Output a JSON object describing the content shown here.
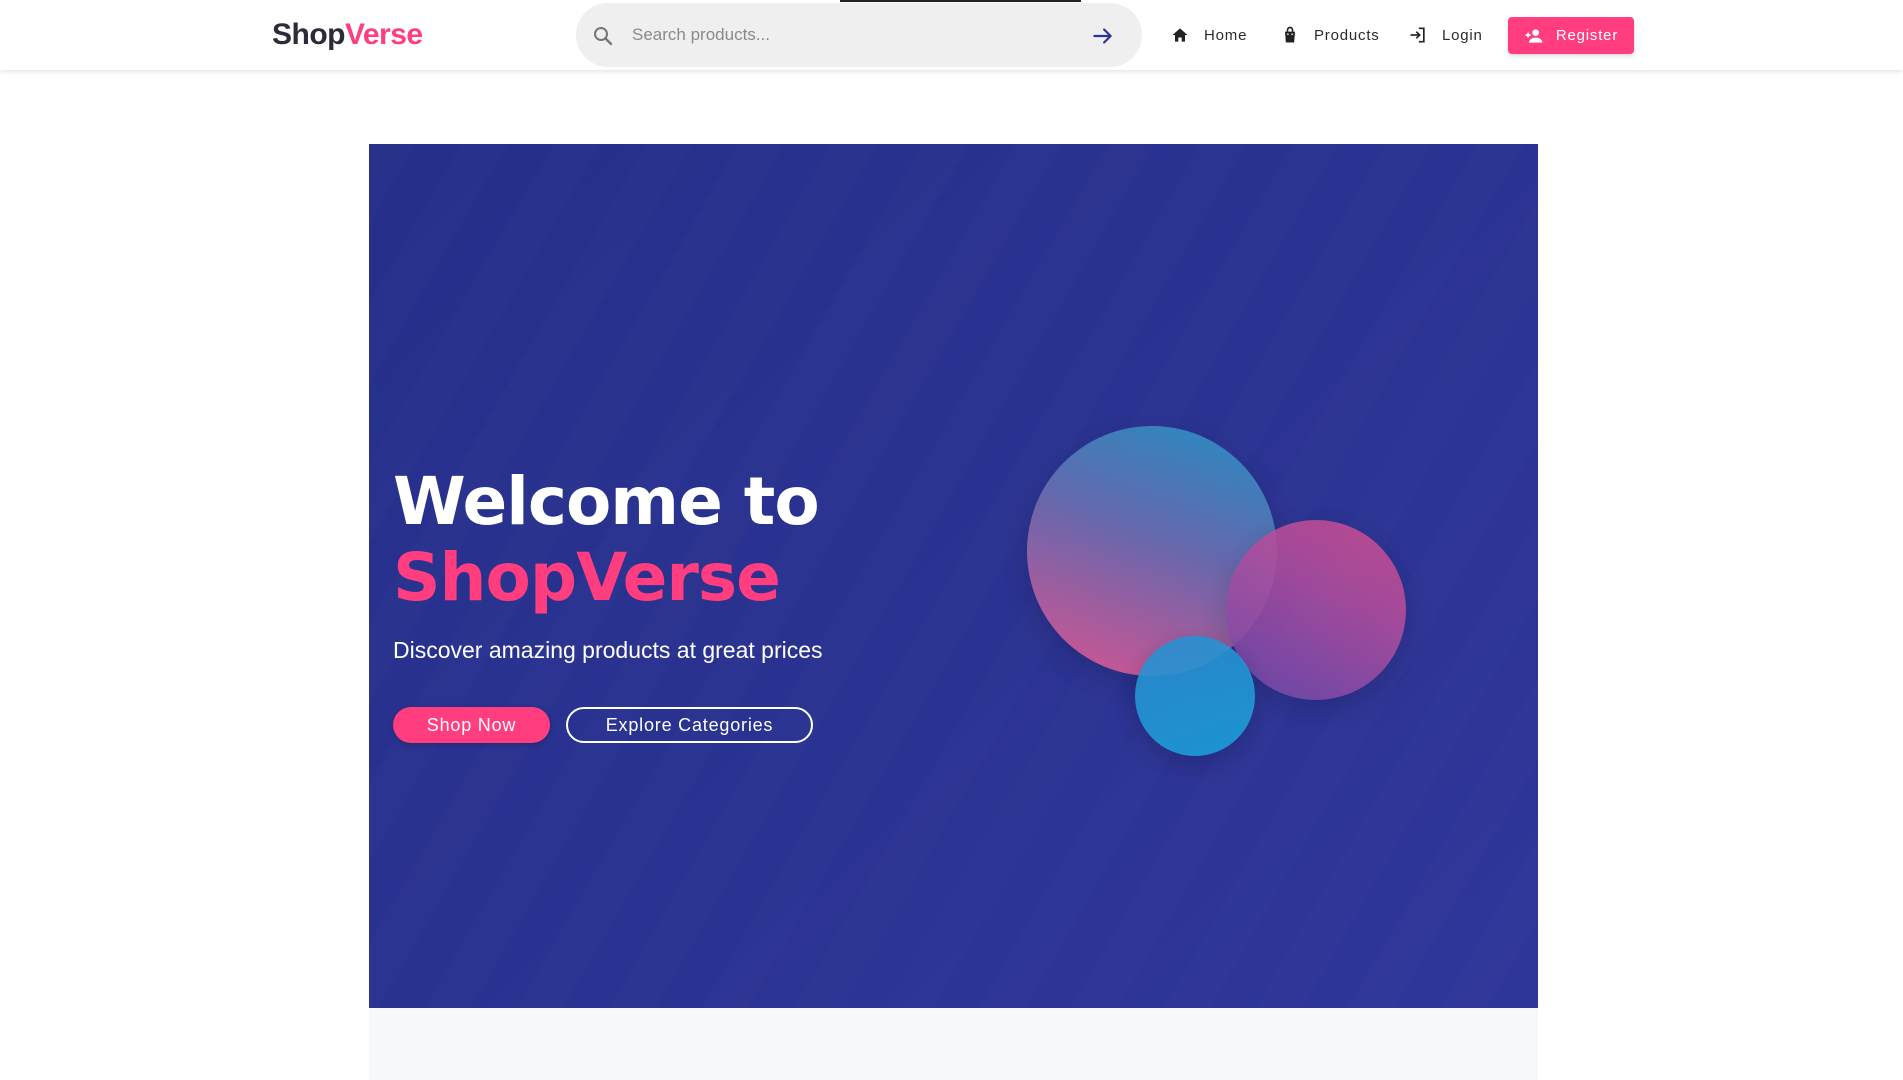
{
  "header": {
    "brand": {
      "part1": "Shop",
      "part2": "Verse"
    },
    "search": {
      "placeholder": "Search products...",
      "value": ""
    },
    "nav": {
      "home": "Home",
      "products": "Products",
      "login": "Login",
      "register": "Register"
    }
  },
  "hero": {
    "title_line1": "Welcome to",
    "title_line2": "ShopVerse",
    "subtitle": "Discover amazing products at great prices",
    "primary_button": "Shop Now",
    "secondary_button": "Explore Categories"
  },
  "icons": {
    "search": "search-icon",
    "go": "arrow-right-icon",
    "home": "home-icon",
    "products": "shopping-bag-icon",
    "login": "login-icon",
    "register": "person-add-icon"
  },
  "colors": {
    "accent": "#ff3d7f",
    "hero_bg": "#2b3392",
    "brand_dark": "#2b2b3a"
  }
}
